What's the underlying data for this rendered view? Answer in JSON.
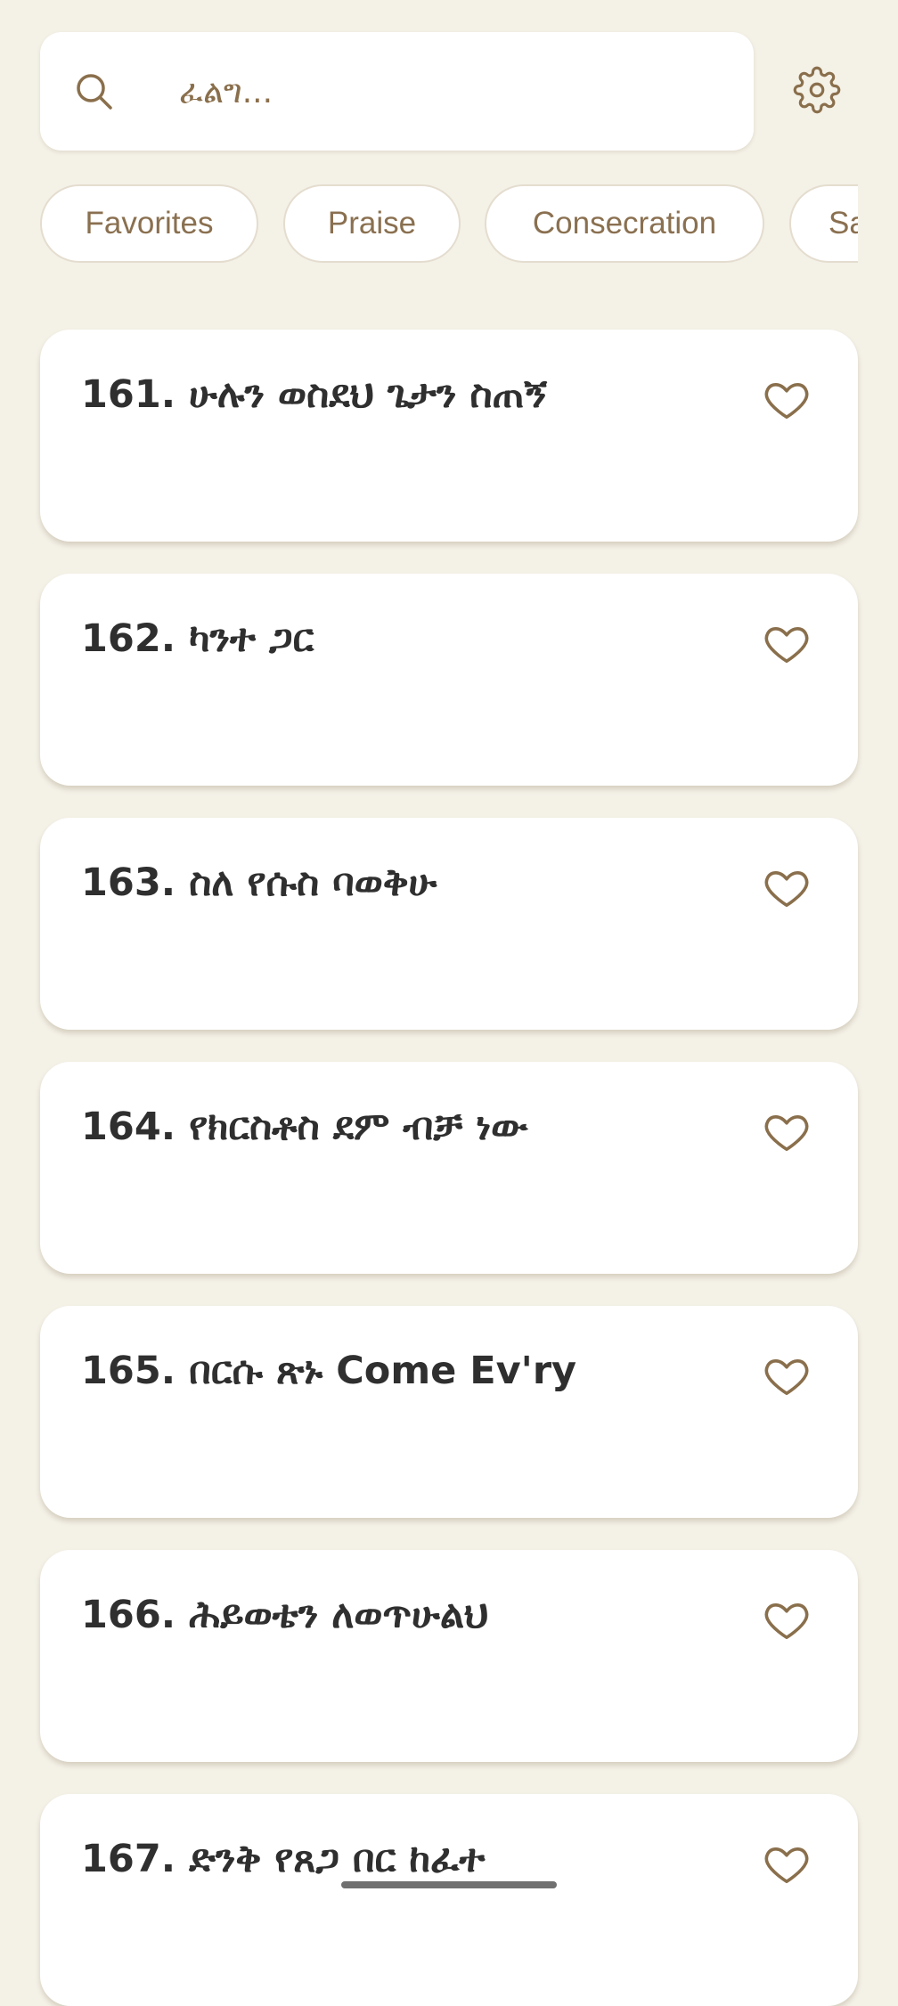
{
  "search": {
    "placeholder": "ፈልግ..."
  },
  "filters": [
    {
      "label": "Favorites"
    },
    {
      "label": "Praise"
    },
    {
      "label": "Consecration"
    },
    {
      "label": "Sa"
    }
  ],
  "songs": [
    {
      "title": "161. ሁሉን ወስደህ ጌታን ስጠኝ"
    },
    {
      "title": "162. ካንተ ጋር"
    },
    {
      "title": "163. ስለ የሱስ ባወቅሁ"
    },
    {
      "title": "164. የክርስቶስ ደም ብቻ ነው"
    },
    {
      "title": "165. በርሱ ጽኑ Come Ev'ry"
    },
    {
      "title": "166. ሕይወቴን ለወጥሁልህ"
    },
    {
      "title": "167. ድንቅ የጸጋ በር ከፈተ"
    }
  ],
  "icons": {
    "search": "search-icon",
    "settings": "gear-icon",
    "favorite": "heart-outline-icon"
  },
  "colors": {
    "background": "#f4f1e7",
    "accent": "#8a6f4c",
    "card": "#ffffff",
    "title_text": "#2f2f2f"
  }
}
